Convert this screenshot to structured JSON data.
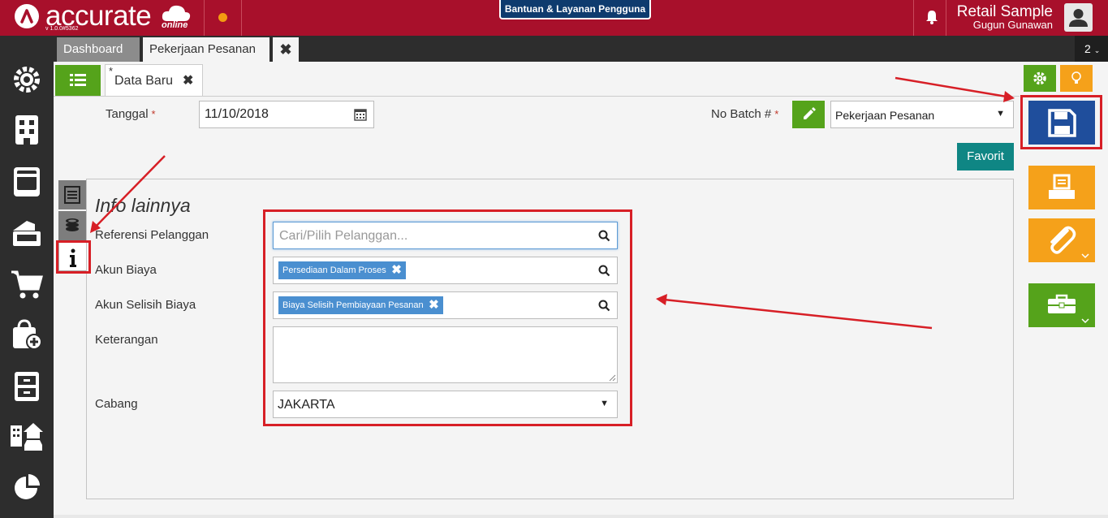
{
  "brand": {
    "name": "accurate",
    "suffix": "online",
    "version": "v 1.0.0#5362"
  },
  "help_badge": "Bantuan & Layanan Pengguna",
  "company": {
    "name": "Retail Sample",
    "user": "Gugun Gunawan"
  },
  "tabs": {
    "dashboard": "Dashboard",
    "pekerjaan": "Pekerjaan Pesanan",
    "close": "✖",
    "count": "2"
  },
  "subtab": {
    "star": "*",
    "label": "Data Baru",
    "close": "✖"
  },
  "form": {
    "tanggal_label": "Tanggal",
    "tanggal_value": "11/10/2018",
    "batch_label": "No Batch #",
    "batch_value": "Pekerjaan Pesanan",
    "required_mark": "*",
    "favorit": "Favorit"
  },
  "panel": {
    "title": "Info lainnya",
    "referensi_label": "Referensi Pelanggan",
    "referensi_placeholder": "Cari/Pilih Pelanggan...",
    "akun_biaya_label": "Akun Biaya",
    "akun_biaya_chip": "Persediaan Dalam Proses",
    "akun_selisih_label": "Akun Selisih Biaya",
    "akun_selisih_chip": "Biaya Selisih Pembiayaan Pesanan",
    "keterangan_label": "Keterangan",
    "cabang_label": "Cabang",
    "cabang_value": "JAKARTA",
    "chip_remove": "✖",
    "info_tab": "i"
  },
  "colors": {
    "topbar": "#a8102b",
    "sidebar": "#2d2d2d",
    "green": "#55a31b",
    "orange": "#f5a11a",
    "save_blue": "#1f4e9c",
    "teal": "#0f8684",
    "annotation_red": "#d71f26"
  },
  "icons": [
    "settings-icon",
    "building-icon",
    "book-icon",
    "money-hand-icon",
    "cart-icon",
    "bag-plus-icon",
    "archive-icon",
    "property-icon",
    "pie-chart-icon",
    "bell-icon",
    "user-icon",
    "list-icon",
    "gear-icon",
    "bulb-icon",
    "calendar-icon",
    "pencil-icon",
    "save-icon",
    "print-icon",
    "paperclip-icon",
    "toolbox-icon",
    "search-icon",
    "info-icon"
  ]
}
